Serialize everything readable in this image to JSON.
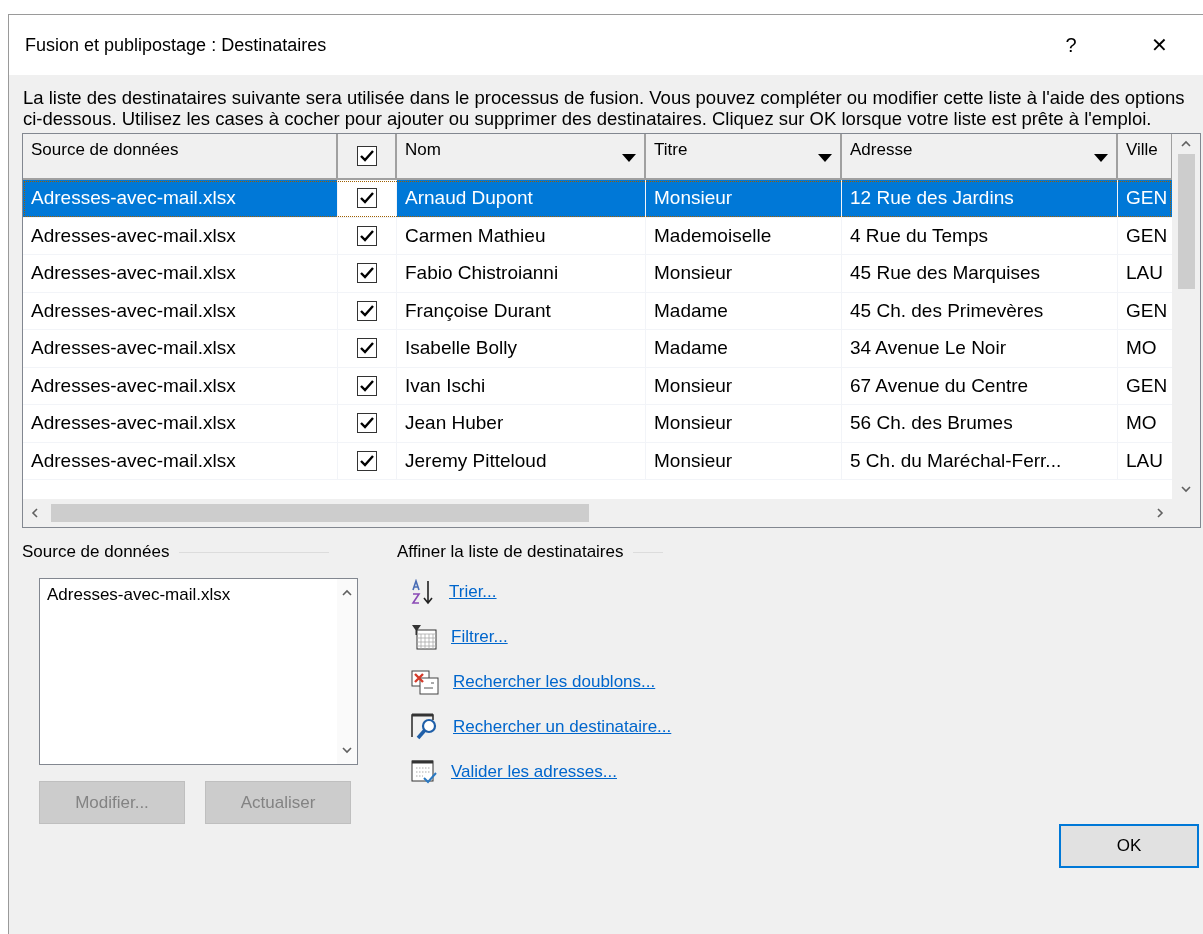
{
  "window": {
    "title": "Fusion et publipostage : Destinataires",
    "help": "?",
    "close": "✕"
  },
  "description": "La liste des destinataires suivante sera utilisée dans le processus de fusion. Vous pouvez compléter ou modifier cette liste à l'aide des options ci-dessous. Utilisez les cases à cocher pour ajouter ou supprimer des destinataires. Cliquez sur OK lorsque votre liste est prête à l'emploi.",
  "table": {
    "header_checked": true,
    "columns": [
      {
        "kind": "text",
        "label": "Source de données",
        "dropdown": false
      },
      {
        "kind": "check"
      },
      {
        "kind": "text",
        "label": "Nom",
        "dropdown": true
      },
      {
        "kind": "text",
        "label": "Titre",
        "dropdown": true
      },
      {
        "kind": "text",
        "label": "Adresse",
        "dropdown": true
      },
      {
        "kind": "text",
        "label": "Ville",
        "dropdown": false
      }
    ],
    "rows": [
      {
        "selected": true,
        "checked": true,
        "cells": [
          "Adresses-avec-mail.xlsx",
          "",
          "Arnaud Dupont",
          "Monsieur",
          "12 Rue des Jardins",
          "GEN"
        ]
      },
      {
        "selected": false,
        "checked": true,
        "cells": [
          "Adresses-avec-mail.xlsx",
          "",
          "Carmen Mathieu",
          "Mademoiselle",
          "4 Rue du Temps",
          "GEN"
        ]
      },
      {
        "selected": false,
        "checked": true,
        "cells": [
          "Adresses-avec-mail.xlsx",
          "",
          "Fabio Chistroianni",
          "Monsieur",
          "45 Rue des Marquises",
          "LAU"
        ]
      },
      {
        "selected": false,
        "checked": true,
        "cells": [
          "Adresses-avec-mail.xlsx",
          "",
          "Françoise Durant",
          "Madame",
          "45 Ch. des Primevères",
          "GEN"
        ]
      },
      {
        "selected": false,
        "checked": true,
        "cells": [
          "Adresses-avec-mail.xlsx",
          "",
          "Isabelle Bolly",
          "Madame",
          "34 Avenue Le Noir",
          "MO"
        ]
      },
      {
        "selected": false,
        "checked": true,
        "cells": [
          "Adresses-avec-mail.xlsx",
          "",
          "Ivan Ischi",
          "Monsieur",
          "67 Avenue du Centre",
          "GEN"
        ]
      },
      {
        "selected": false,
        "checked": true,
        "cells": [
          "Adresses-avec-mail.xlsx",
          "",
          "Jean Huber",
          "Monsieur",
          "56 Ch. des Brumes",
          "MO"
        ]
      },
      {
        "selected": false,
        "checked": true,
        "cells": [
          "Adresses-avec-mail.xlsx",
          "",
          "Jeremy Pitteloud",
          "Monsieur",
          "5 Ch. du Maréchal-Ferr...",
          "LAU"
        ]
      }
    ]
  },
  "data_source": {
    "heading": "Source de données",
    "items": [
      "Adresses-avec-mail.xlsx"
    ],
    "buttons": [
      {
        "label": "Modifier...",
        "disabled": true
      },
      {
        "label": "Actualiser",
        "disabled": true
      }
    ]
  },
  "refine": {
    "heading": "Affiner la liste de destinataires",
    "links": [
      {
        "kind": "sort",
        "label": "Trier..."
      },
      {
        "kind": "filter",
        "label": "Filtrer..."
      },
      {
        "kind": "duplicates",
        "label": "Rechercher les doublons..."
      },
      {
        "kind": "find",
        "label": "Rechercher un destinataire..."
      },
      {
        "kind": "validate",
        "label": "Valider les adresses..."
      }
    ]
  },
  "ok_button": "OK"
}
